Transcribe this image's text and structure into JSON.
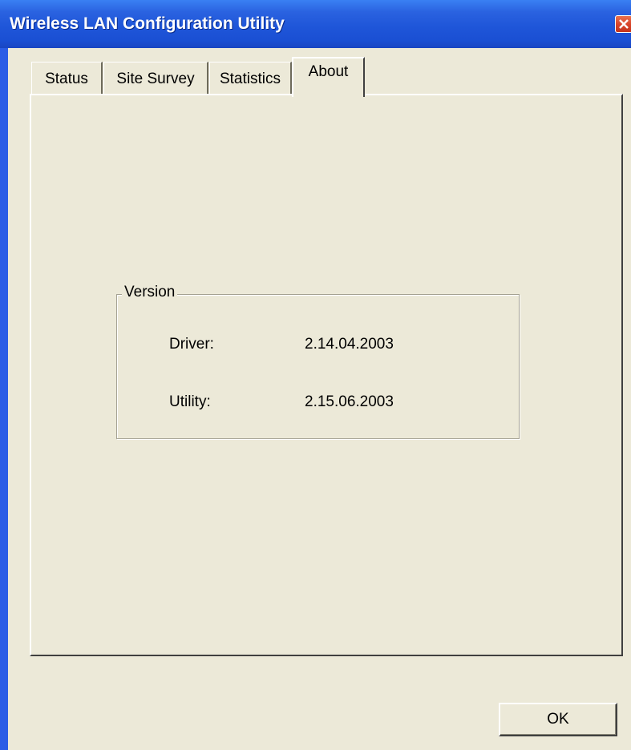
{
  "window": {
    "title": "Wireless LAN Configuration Utility"
  },
  "tabs": [
    {
      "label": "Status",
      "active": false
    },
    {
      "label": "Site Survey",
      "active": false
    },
    {
      "label": "Statistics",
      "active": false
    },
    {
      "label": "About",
      "active": true
    }
  ],
  "version_group": {
    "legend": "Version",
    "driver_label": "Driver:",
    "driver_value": "2.14.04.2003",
    "utility_label": "Utility:",
    "utility_value": "2.15.06.2003"
  },
  "buttons": {
    "ok_label": "OK"
  },
  "colors": {
    "titlebar": "#1f56d9",
    "dialog_face": "#ece9d8",
    "close_button": "#d9452b"
  },
  "icons": {
    "close": "close-icon"
  }
}
